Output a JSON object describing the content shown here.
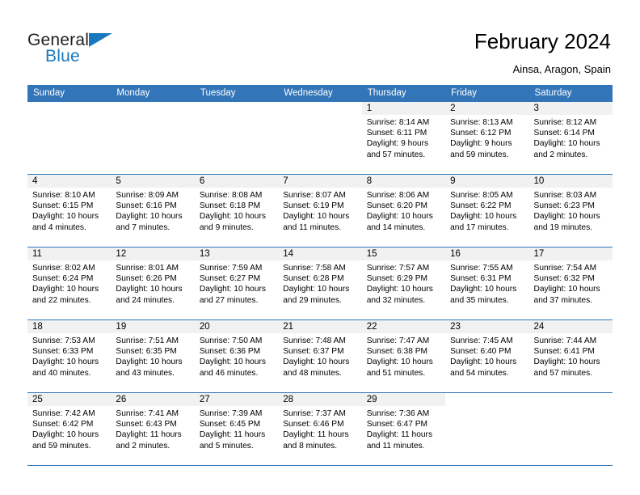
{
  "logo": {
    "word1": "General",
    "word2": "Blue",
    "triangle_icon": "triangle-right-icon",
    "accent_color": "#1878be"
  },
  "header": {
    "title": "February 2024",
    "subtitle": "Ainsa, Aragon, Spain",
    "header_bg_color": "#3275b8",
    "daynum_bg_color": "#f1f1f1"
  },
  "weekday_headers": [
    "Sunday",
    "Monday",
    "Tuesday",
    "Wednesday",
    "Thursday",
    "Friday",
    "Saturday"
  ],
  "weeks": [
    [
      {
        "day": "",
        "sunrise": "",
        "sunset": "",
        "daylight_line1": "",
        "daylight_line2": ""
      },
      {
        "day": "",
        "sunrise": "",
        "sunset": "",
        "daylight_line1": "",
        "daylight_line2": ""
      },
      {
        "day": "",
        "sunrise": "",
        "sunset": "",
        "daylight_line1": "",
        "daylight_line2": ""
      },
      {
        "day": "",
        "sunrise": "",
        "sunset": "",
        "daylight_line1": "",
        "daylight_line2": ""
      },
      {
        "day": "1",
        "sunrise": "Sunrise: 8:14 AM",
        "sunset": "Sunset: 6:11 PM",
        "daylight_line1": "Daylight: 9 hours",
        "daylight_line2": "and 57 minutes."
      },
      {
        "day": "2",
        "sunrise": "Sunrise: 8:13 AM",
        "sunset": "Sunset: 6:12 PM",
        "daylight_line1": "Daylight: 9 hours",
        "daylight_line2": "and 59 minutes."
      },
      {
        "day": "3",
        "sunrise": "Sunrise: 8:12 AM",
        "sunset": "Sunset: 6:14 PM",
        "daylight_line1": "Daylight: 10 hours",
        "daylight_line2": "and 2 minutes."
      }
    ],
    [
      {
        "day": "4",
        "sunrise": "Sunrise: 8:10 AM",
        "sunset": "Sunset: 6:15 PM",
        "daylight_line1": "Daylight: 10 hours",
        "daylight_line2": "and 4 minutes."
      },
      {
        "day": "5",
        "sunrise": "Sunrise: 8:09 AM",
        "sunset": "Sunset: 6:16 PM",
        "daylight_line1": "Daylight: 10 hours",
        "daylight_line2": "and 7 minutes."
      },
      {
        "day": "6",
        "sunrise": "Sunrise: 8:08 AM",
        "sunset": "Sunset: 6:18 PM",
        "daylight_line1": "Daylight: 10 hours",
        "daylight_line2": "and 9 minutes."
      },
      {
        "day": "7",
        "sunrise": "Sunrise: 8:07 AM",
        "sunset": "Sunset: 6:19 PM",
        "daylight_line1": "Daylight: 10 hours",
        "daylight_line2": "and 11 minutes."
      },
      {
        "day": "8",
        "sunrise": "Sunrise: 8:06 AM",
        "sunset": "Sunset: 6:20 PM",
        "daylight_line1": "Daylight: 10 hours",
        "daylight_line2": "and 14 minutes."
      },
      {
        "day": "9",
        "sunrise": "Sunrise: 8:05 AM",
        "sunset": "Sunset: 6:22 PM",
        "daylight_line1": "Daylight: 10 hours",
        "daylight_line2": "and 17 minutes."
      },
      {
        "day": "10",
        "sunrise": "Sunrise: 8:03 AM",
        "sunset": "Sunset: 6:23 PM",
        "daylight_line1": "Daylight: 10 hours",
        "daylight_line2": "and 19 minutes."
      }
    ],
    [
      {
        "day": "11",
        "sunrise": "Sunrise: 8:02 AM",
        "sunset": "Sunset: 6:24 PM",
        "daylight_line1": "Daylight: 10 hours",
        "daylight_line2": "and 22 minutes."
      },
      {
        "day": "12",
        "sunrise": "Sunrise: 8:01 AM",
        "sunset": "Sunset: 6:26 PM",
        "daylight_line1": "Daylight: 10 hours",
        "daylight_line2": "and 24 minutes."
      },
      {
        "day": "13",
        "sunrise": "Sunrise: 7:59 AM",
        "sunset": "Sunset: 6:27 PM",
        "daylight_line1": "Daylight: 10 hours",
        "daylight_line2": "and 27 minutes."
      },
      {
        "day": "14",
        "sunrise": "Sunrise: 7:58 AM",
        "sunset": "Sunset: 6:28 PM",
        "daylight_line1": "Daylight: 10 hours",
        "daylight_line2": "and 29 minutes."
      },
      {
        "day": "15",
        "sunrise": "Sunrise: 7:57 AM",
        "sunset": "Sunset: 6:29 PM",
        "daylight_line1": "Daylight: 10 hours",
        "daylight_line2": "and 32 minutes."
      },
      {
        "day": "16",
        "sunrise": "Sunrise: 7:55 AM",
        "sunset": "Sunset: 6:31 PM",
        "daylight_line1": "Daylight: 10 hours",
        "daylight_line2": "and 35 minutes."
      },
      {
        "day": "17",
        "sunrise": "Sunrise: 7:54 AM",
        "sunset": "Sunset: 6:32 PM",
        "daylight_line1": "Daylight: 10 hours",
        "daylight_line2": "and 37 minutes."
      }
    ],
    [
      {
        "day": "18",
        "sunrise": "Sunrise: 7:53 AM",
        "sunset": "Sunset: 6:33 PM",
        "daylight_line1": "Daylight: 10 hours",
        "daylight_line2": "and 40 minutes."
      },
      {
        "day": "19",
        "sunrise": "Sunrise: 7:51 AM",
        "sunset": "Sunset: 6:35 PM",
        "daylight_line1": "Daylight: 10 hours",
        "daylight_line2": "and 43 minutes."
      },
      {
        "day": "20",
        "sunrise": "Sunrise: 7:50 AM",
        "sunset": "Sunset: 6:36 PM",
        "daylight_line1": "Daylight: 10 hours",
        "daylight_line2": "and 46 minutes."
      },
      {
        "day": "21",
        "sunrise": "Sunrise: 7:48 AM",
        "sunset": "Sunset: 6:37 PM",
        "daylight_line1": "Daylight: 10 hours",
        "daylight_line2": "and 48 minutes."
      },
      {
        "day": "22",
        "sunrise": "Sunrise: 7:47 AM",
        "sunset": "Sunset: 6:38 PM",
        "daylight_line1": "Daylight: 10 hours",
        "daylight_line2": "and 51 minutes."
      },
      {
        "day": "23",
        "sunrise": "Sunrise: 7:45 AM",
        "sunset": "Sunset: 6:40 PM",
        "daylight_line1": "Daylight: 10 hours",
        "daylight_line2": "and 54 minutes."
      },
      {
        "day": "24",
        "sunrise": "Sunrise: 7:44 AM",
        "sunset": "Sunset: 6:41 PM",
        "daylight_line1": "Daylight: 10 hours",
        "daylight_line2": "and 57 minutes."
      }
    ],
    [
      {
        "day": "25",
        "sunrise": "Sunrise: 7:42 AM",
        "sunset": "Sunset: 6:42 PM",
        "daylight_line1": "Daylight: 10 hours",
        "daylight_line2": "and 59 minutes."
      },
      {
        "day": "26",
        "sunrise": "Sunrise: 7:41 AM",
        "sunset": "Sunset: 6:43 PM",
        "daylight_line1": "Daylight: 11 hours",
        "daylight_line2": "and 2 minutes."
      },
      {
        "day": "27",
        "sunrise": "Sunrise: 7:39 AM",
        "sunset": "Sunset: 6:45 PM",
        "daylight_line1": "Daylight: 11 hours",
        "daylight_line2": "and 5 minutes."
      },
      {
        "day": "28",
        "sunrise": "Sunrise: 7:37 AM",
        "sunset": "Sunset: 6:46 PM",
        "daylight_line1": "Daylight: 11 hours",
        "daylight_line2": "and 8 minutes."
      },
      {
        "day": "29",
        "sunrise": "Sunrise: 7:36 AM",
        "sunset": "Sunset: 6:47 PM",
        "daylight_line1": "Daylight: 11 hours",
        "daylight_line2": "and 11 minutes."
      },
      {
        "day": "",
        "sunrise": "",
        "sunset": "",
        "daylight_line1": "",
        "daylight_line2": ""
      },
      {
        "day": "",
        "sunrise": "",
        "sunset": "",
        "daylight_line1": "",
        "daylight_line2": ""
      }
    ]
  ]
}
